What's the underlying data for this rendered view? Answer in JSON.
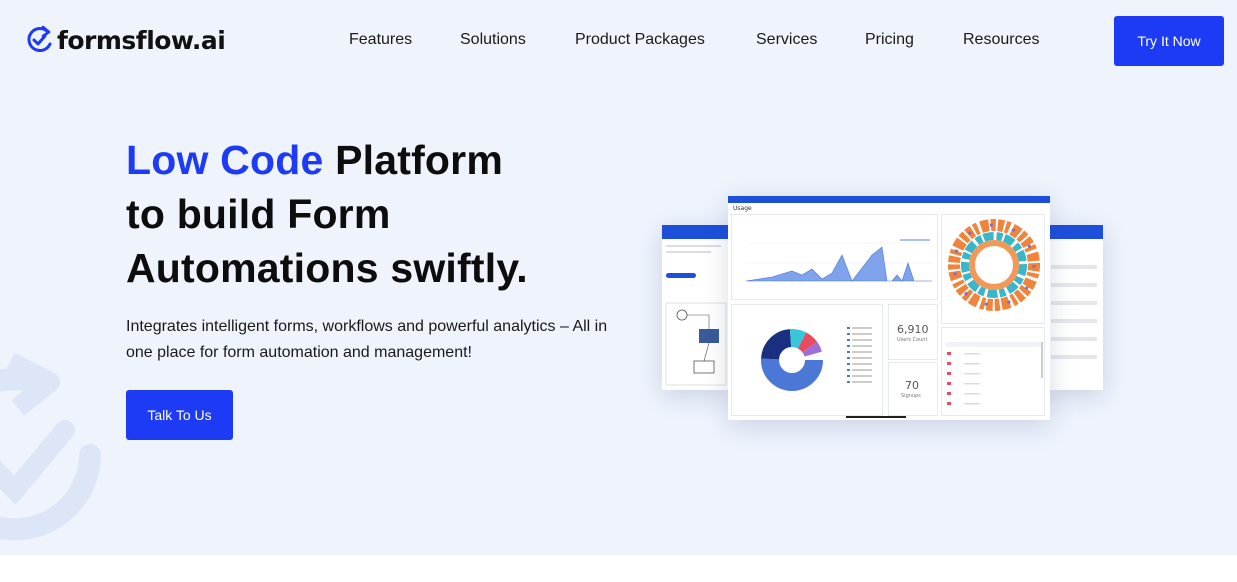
{
  "brand": {
    "name": "formsflow.ai",
    "accent": "#1d3bf5"
  },
  "nav": {
    "items": [
      "Features",
      "Solutions",
      "Product Packages",
      "Services",
      "Pricing",
      "Resources"
    ],
    "cta": "Try It Now"
  },
  "hero": {
    "headline_accent": "Low Code",
    "headline_line1_rest": " Platform",
    "headline_line2": "to build Form",
    "headline_line3": "Automations swiftly.",
    "subtitle": "Integrates intelligent forms, workflows and powerful analytics – All in one place for form automation and management!",
    "cta": "Talk To Us"
  },
  "dashboard": {
    "title": "Usage",
    "users_count": "6,910",
    "users_label": "Users Count",
    "signups_count": "70",
    "signups_label": "Signups"
  }
}
